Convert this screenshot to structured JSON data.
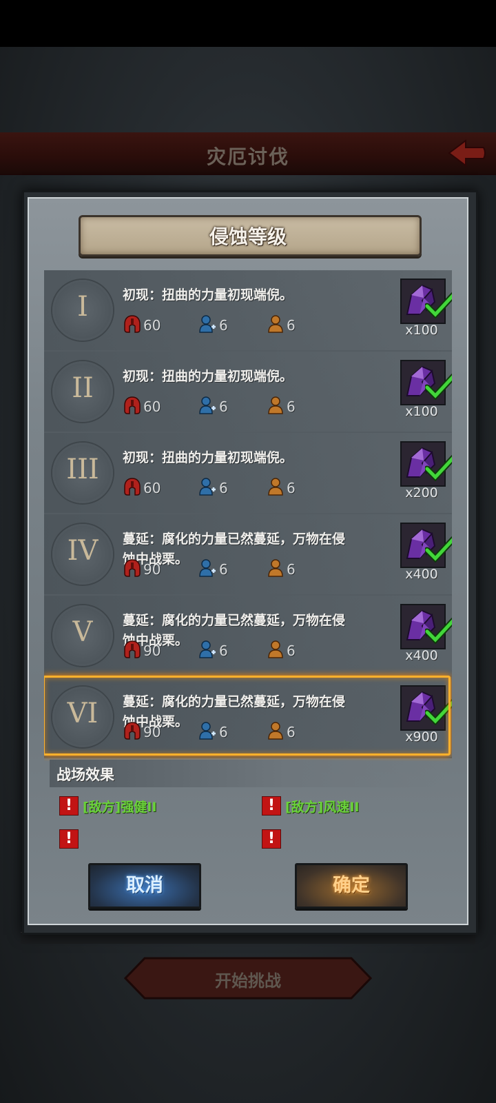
{
  "background": {
    "screen_title": "灾厄讨伐",
    "start_button_label": "开始挑战"
  },
  "modal": {
    "title": "侵蚀等级",
    "levels": [
      {
        "roman": "I",
        "desc": "初现：扭曲的力量初现端倪。",
        "stat_red": "60",
        "stat_blue": "6",
        "stat_orange": "6",
        "reward_qty": "x100",
        "claimed": true
      },
      {
        "roman": "II",
        "desc": "初现：扭曲的力量初现端倪。",
        "stat_red": "60",
        "stat_blue": "6",
        "stat_orange": "6",
        "reward_qty": "x100",
        "claimed": true
      },
      {
        "roman": "III",
        "desc": "初现：扭曲的力量初现端倪。",
        "stat_red": "60",
        "stat_blue": "6",
        "stat_orange": "6",
        "reward_qty": "x200",
        "claimed": true
      },
      {
        "roman": "IV",
        "desc": "蔓延：腐化的力量已然蔓延，万物在侵蚀中战栗。",
        "stat_red": "90",
        "stat_blue": "6",
        "stat_orange": "6",
        "reward_qty": "x400",
        "claimed": true
      },
      {
        "roman": "V",
        "desc": "蔓延：腐化的力量已然蔓延，万物在侵蚀中战栗。",
        "stat_red": "90",
        "stat_blue": "6",
        "stat_orange": "6",
        "reward_qty": "x400",
        "claimed": true
      },
      {
        "roman": "VI",
        "desc": "蔓延：腐化的力量已然蔓延，万物在侵蚀中战栗。",
        "stat_red": "90",
        "stat_blue": "6",
        "stat_orange": "6",
        "reward_qty": "x900",
        "claimed": true,
        "selected": true
      }
    ],
    "effects_title": "战场效果",
    "effects": [
      "[敌方]强健II",
      "[敌方]风速II"
    ],
    "cancel_label": "取消",
    "confirm_label": "确定"
  },
  "colors": {
    "selected_border": "#ffb12c",
    "effect_text": "#6ad13a",
    "warning_red": "#c21414"
  }
}
